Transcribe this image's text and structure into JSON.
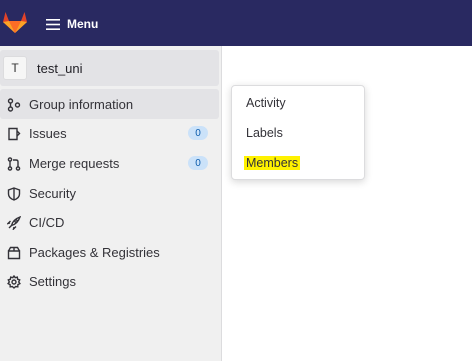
{
  "topbar": {
    "logo_icon": "gitlab-tanuki-icon",
    "menu_label": "Menu",
    "menu_icon": "hamburger-icon"
  },
  "sidebar": {
    "context": {
      "avatar_letter": "T",
      "name": "test_uni"
    },
    "items": [
      {
        "label": "Group information",
        "icon": "group-icon",
        "active": true
      },
      {
        "label": "Issues",
        "icon": "issues-icon",
        "badge": "0"
      },
      {
        "label": "Merge requests",
        "icon": "merge-request-icon",
        "badge": "0"
      },
      {
        "label": "Security",
        "icon": "shield-icon"
      },
      {
        "label": "CI/CD",
        "icon": "rocket-icon"
      },
      {
        "label": "Packages & Registries",
        "icon": "package-icon"
      },
      {
        "label": "Settings",
        "icon": "gear-icon"
      }
    ]
  },
  "flyout": {
    "items": [
      {
        "label": "Activity"
      },
      {
        "label": "Labels"
      },
      {
        "label": "Members",
        "highlighted": true
      }
    ]
  },
  "colors": {
    "topbar": "#292961",
    "badge_bg": "#cbe2f9",
    "highlight": "#fff200"
  }
}
